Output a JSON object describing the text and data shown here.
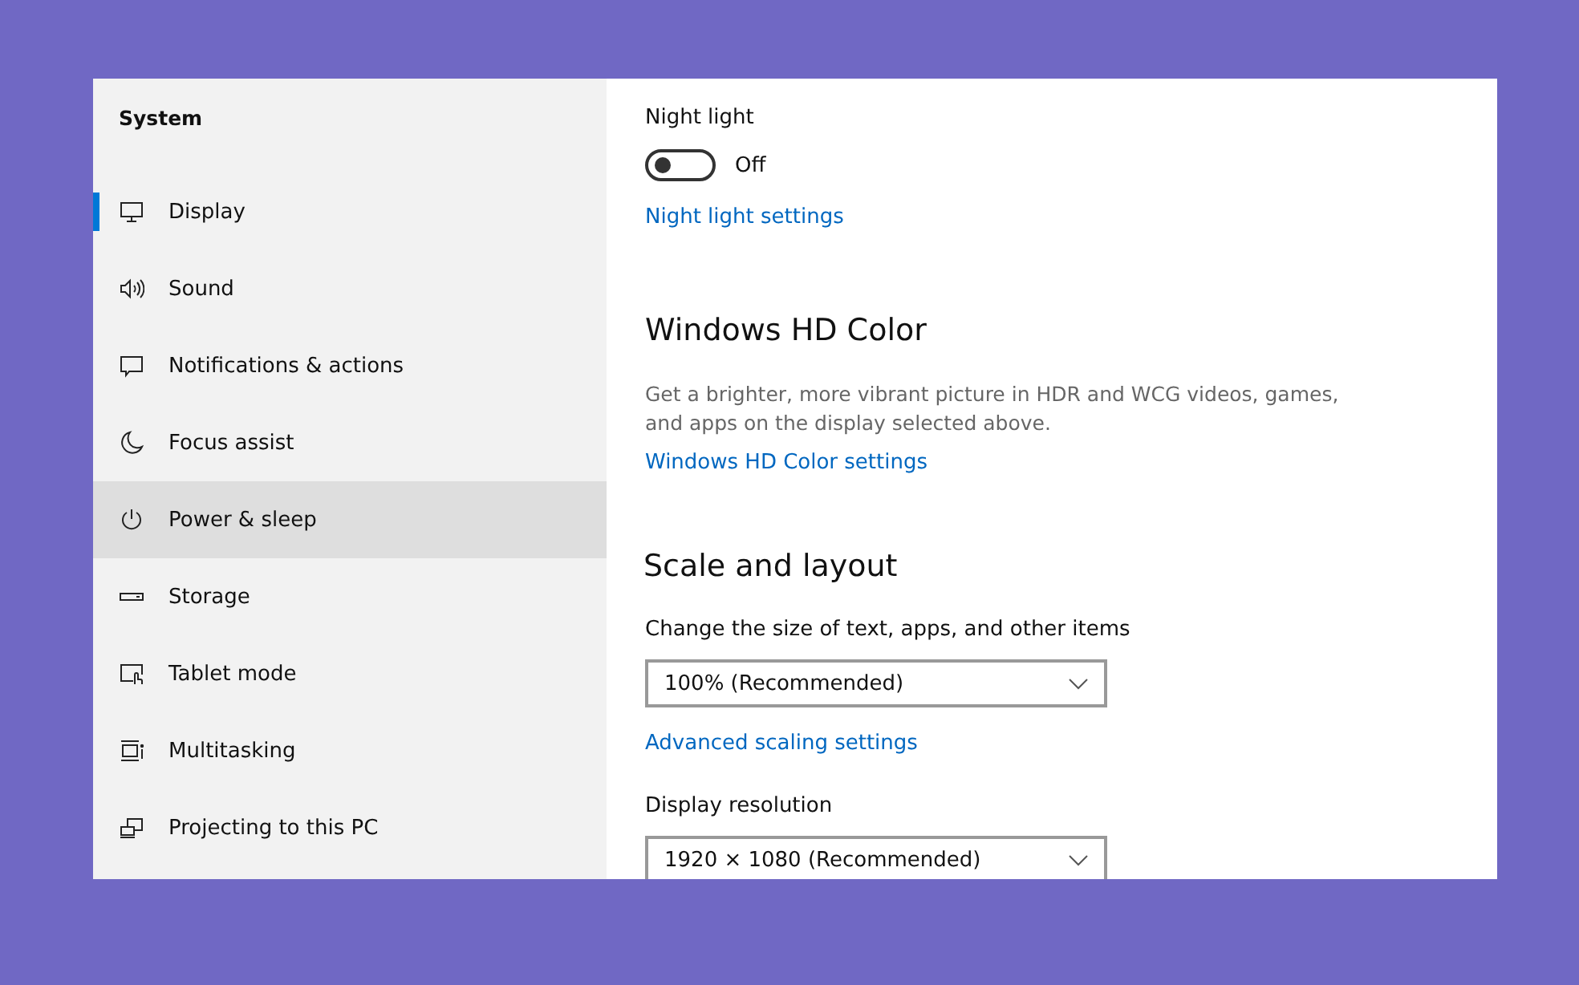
{
  "sidebar": {
    "title": "System",
    "items": [
      {
        "label": "Display",
        "selected": true,
        "hovered": false
      },
      {
        "label": "Sound",
        "selected": false,
        "hovered": false
      },
      {
        "label": "Notifications & actions",
        "selected": false,
        "hovered": false
      },
      {
        "label": "Focus assist",
        "selected": false,
        "hovered": false
      },
      {
        "label": "Power & sleep",
        "selected": false,
        "hovered": true
      },
      {
        "label": "Storage",
        "selected": false,
        "hovered": false
      },
      {
        "label": "Tablet mode",
        "selected": false,
        "hovered": false
      },
      {
        "label": "Multitasking",
        "selected": false,
        "hovered": false
      },
      {
        "label": "Projecting to this PC",
        "selected": false,
        "hovered": false
      }
    ]
  },
  "night_light": {
    "label": "Night light",
    "on": false,
    "state_text": "Off",
    "link": "Night light settings"
  },
  "hd_color": {
    "heading": "Windows HD Color",
    "description": "Get a brighter, more vibrant picture in HDR and WCG videos, games, and apps on the display selected above.",
    "link": "Windows HD Color settings"
  },
  "scale_layout": {
    "heading": "Scale and layout",
    "size_label": "Change the size of text, apps, and other items",
    "size_value": "100% (Recommended)",
    "link": "Advanced scaling settings",
    "resolution_label": "Display resolution",
    "resolution_value": "1920 × 1080 (Recommended)"
  }
}
